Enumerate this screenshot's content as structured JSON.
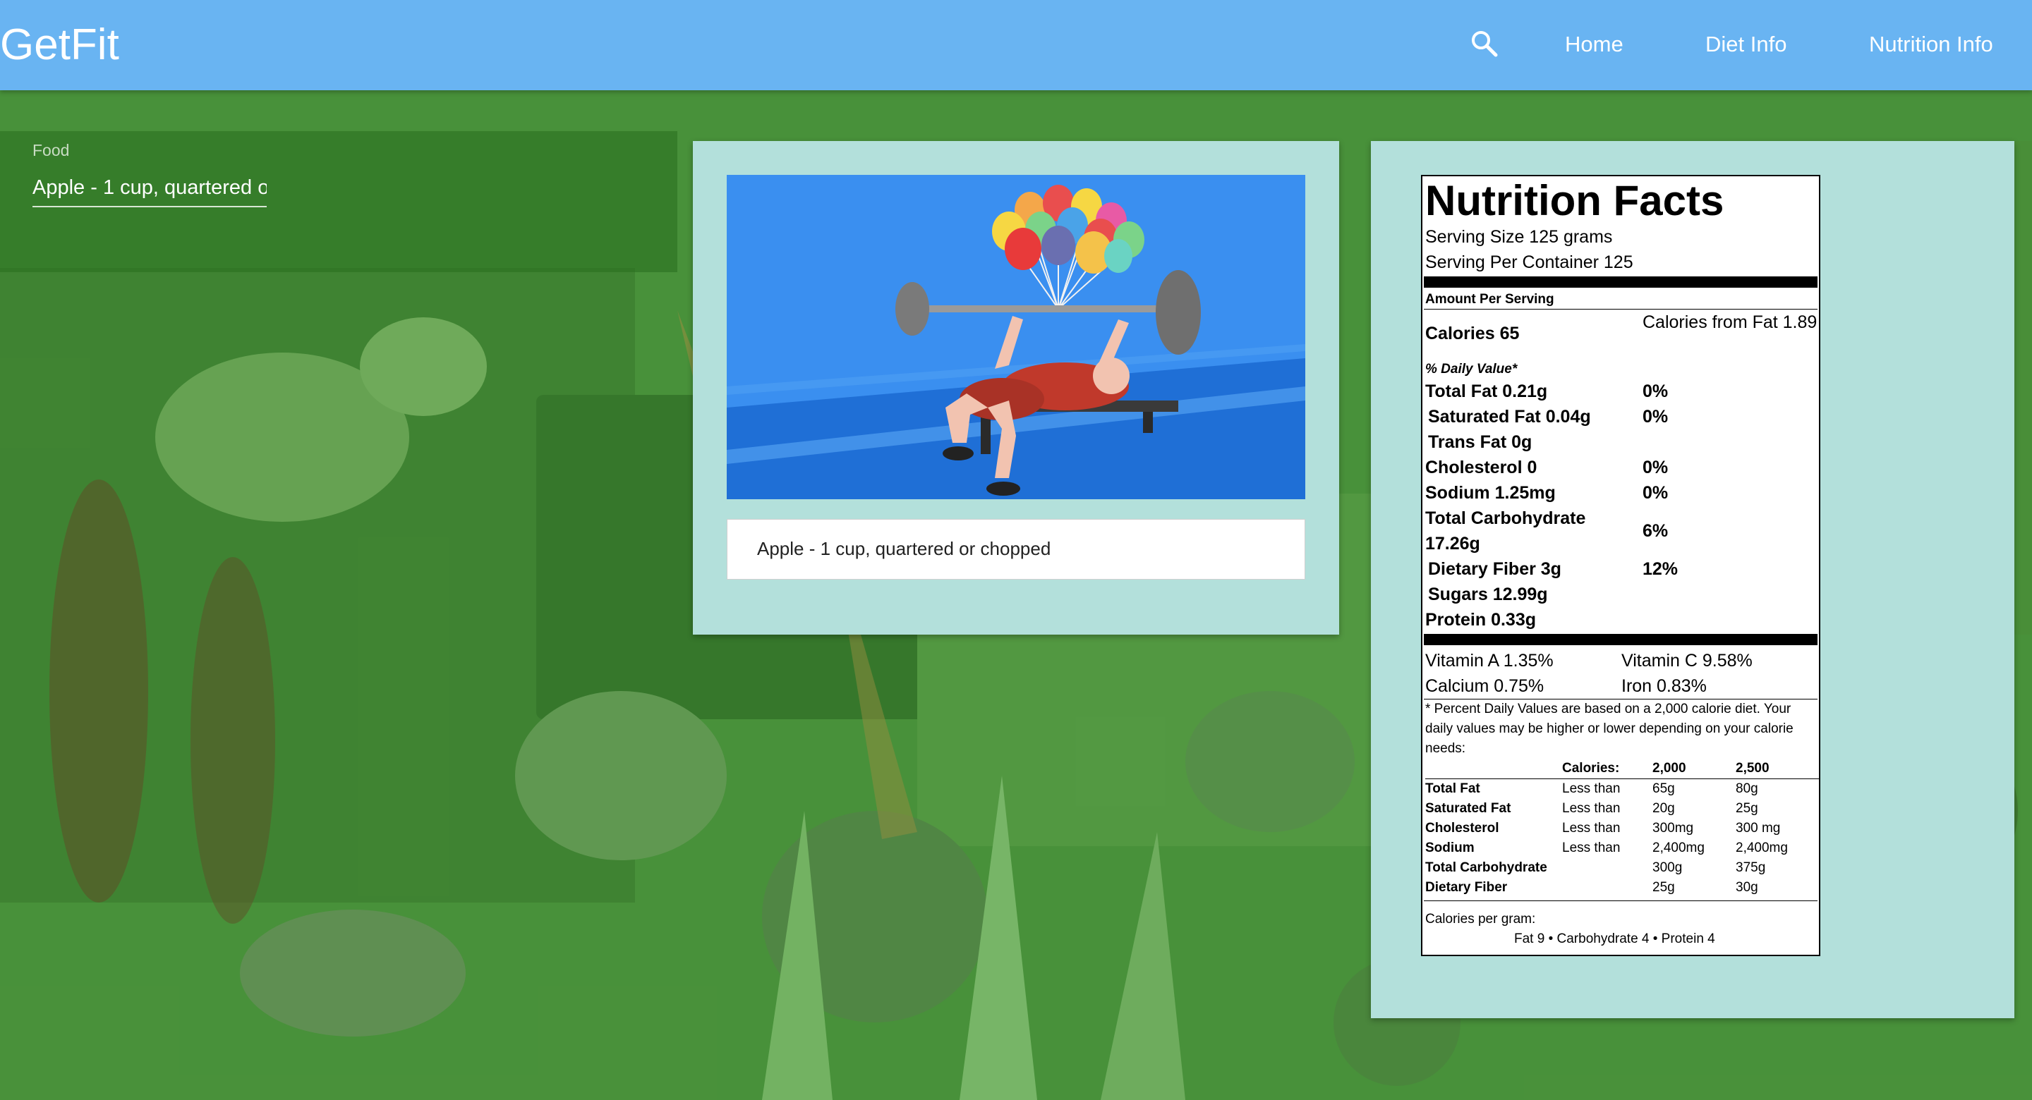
{
  "header": {
    "brand": "GetFit",
    "nav": {
      "home": "Home",
      "diet": "Diet Info",
      "nutrition": "Nutrition Info"
    },
    "search_icon": "search-icon"
  },
  "food_search": {
    "label": "Food",
    "value": "Apple - 1 cup, quartered or chopped"
  },
  "food_card": {
    "image": "weightlifter-with-balloons-illustration",
    "caption": "Apple - 1 cup, quartered or chopped"
  },
  "nutrition": {
    "title": "Nutrition Facts",
    "serving_size": "Serving Size 125 grams",
    "servings_per_container": "Serving Per Container 125",
    "amount_per_serving": "Amount Per Serving",
    "calories": "Calories 65",
    "calories_from_fat": "Calories from Fat 1.89",
    "daily_value_header": "% Daily Value*",
    "nutrients": [
      {
        "name": "Total Fat 0.21g",
        "dv": "0%"
      },
      {
        "name": "Saturated Fat 0.04g",
        "dv": "0%"
      },
      {
        "name": "Trans Fat 0g",
        "dv": ""
      },
      {
        "name": "Cholesterol 0",
        "dv": "0%"
      },
      {
        "name": "Sodium 1.25mg",
        "dv": "0%"
      },
      {
        "name": "Total Carbohydrate 17.26g",
        "dv": "6%"
      },
      {
        "name": "Dietary Fiber 3g",
        "dv": "12%"
      },
      {
        "name": "Sugars 12.99g",
        "dv": ""
      },
      {
        "name": "Protein 0.33g",
        "dv": ""
      }
    ],
    "vitamins": {
      "vitamin_a": "Vitamin A 1.35%",
      "vitamin_c": "Vitamin C 9.58%",
      "calcium": "Calcium 0.75%",
      "iron": "Iron 0.83%"
    },
    "footnote": "* Percent Daily Values are based on a 2,000 calorie diet. Your daily values may be higher or lower depending on your calorie needs:",
    "dv_table": {
      "header": [
        "",
        "Calories:",
        "2,000",
        "2,500"
      ],
      "rows": [
        [
          "Total Fat",
          "Less than",
          "65g",
          "80g"
        ],
        [
          "Saturated Fat",
          "Less than",
          "20g",
          "25g"
        ],
        [
          "Cholesterol",
          "Less than",
          "300mg",
          "300 mg"
        ],
        [
          "Sodium",
          "Less than",
          "2,400mg",
          "2,400mg"
        ],
        [
          "Total Carbohydrate",
          "",
          "300g",
          "375g"
        ],
        [
          "Dietary Fiber",
          "",
          "25g",
          "30g"
        ]
      ]
    },
    "calories_per_gram_label": "Calories per gram:",
    "calories_per_gram": "Fat 9 • Carbohydrate 4 • Protein 4"
  },
  "colors": {
    "header": "#69b4f2",
    "card": "#b3e0db",
    "background": "#3f8a36",
    "hero_sky": "#3a8ff0"
  }
}
